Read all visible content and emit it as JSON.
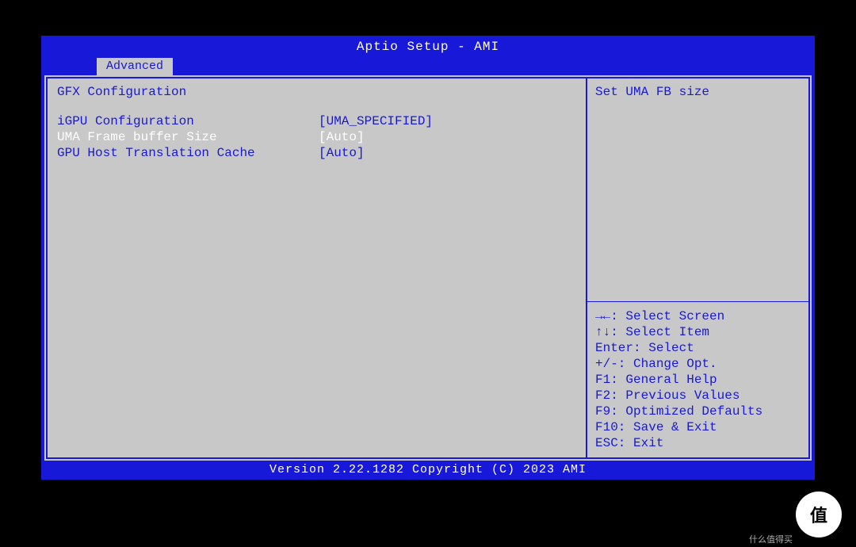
{
  "header": {
    "title": "Aptio Setup - AMI",
    "active_tab": "Advanced"
  },
  "main": {
    "section_title": "GFX Configuration",
    "options": [
      {
        "label": "iGPU Configuration",
        "value": "[UMA_SPECIFIED]",
        "selected": false
      },
      {
        "label": "UMA Frame buffer Size",
        "value": "[Auto]",
        "selected": true
      },
      {
        "label": "GPU Host Translation Cache",
        "value": "[Auto]",
        "selected": false
      }
    ]
  },
  "help": {
    "description": "Set UMA FB size",
    "keys": [
      "→←: Select Screen",
      "↑↓: Select Item",
      "Enter: Select",
      "+/-: Change Opt.",
      "F1: General Help",
      "F2: Previous Values",
      "F9: Optimized Defaults",
      "F10: Save & Exit",
      "ESC: Exit"
    ]
  },
  "footer": {
    "text": "Version 2.22.1282 Copyright (C) 2023 AMI"
  },
  "watermark": {
    "logo": "值",
    "text": "什么值得买"
  }
}
